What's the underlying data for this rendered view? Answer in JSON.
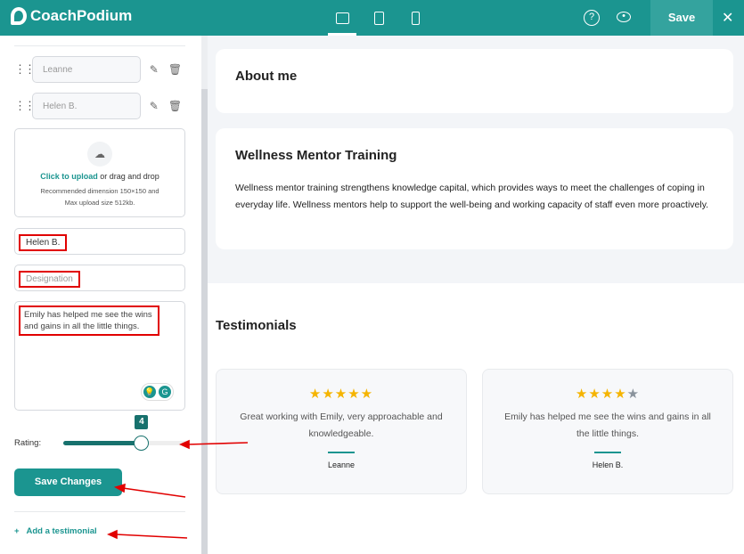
{
  "app": {
    "name": "CoachPodium",
    "save_label": "Save"
  },
  "header_icons": [
    "monitor-icon",
    "tablet-icon",
    "phone-icon",
    "help-icon",
    "eye-icon",
    "close-icon"
  ],
  "sidebar": {
    "testimonials": [
      {
        "name": "Leanne"
      },
      {
        "name": "Helen B."
      }
    ],
    "upload": {
      "link": "Click to upload",
      "text": " or drag and drop",
      "hint1": "Recommended dimension 150×150 and",
      "hint2": "Max upload size 512kb."
    },
    "name_value": "Helen B.",
    "designation_placeholder": "Designation",
    "message_value": "Emily has helped me see the wins and gains in all the little things.",
    "rating_label": "Rating:",
    "rating_value": "4",
    "rating_max": 5,
    "save_changes": "Save Changes",
    "add_testimonial": "Add a testimonial"
  },
  "main": {
    "about_title": "About me",
    "training_title": "Wellness Mentor Training",
    "training_text": "Wellness mentor training strengthens knowledge capital, which provides ways to meet the challenges of coping in everyday life. Wellness mentors help to support the well-being and working capacity of staff even more proactively.",
    "testimonials_title": "Testimonials",
    "cards": [
      {
        "rating": 5,
        "quote": "Great working with Emily, very approachable and knowledgeable.",
        "name": "Leanne"
      },
      {
        "rating": 4,
        "quote": "Emily has helped me see the wins and gains in all the little things.",
        "name": "Helen B."
      }
    ]
  },
  "colors": {
    "brand": "#1b9590",
    "dark_teal": "#17716d",
    "star": "#f5b400",
    "annotation": "#e10000"
  }
}
